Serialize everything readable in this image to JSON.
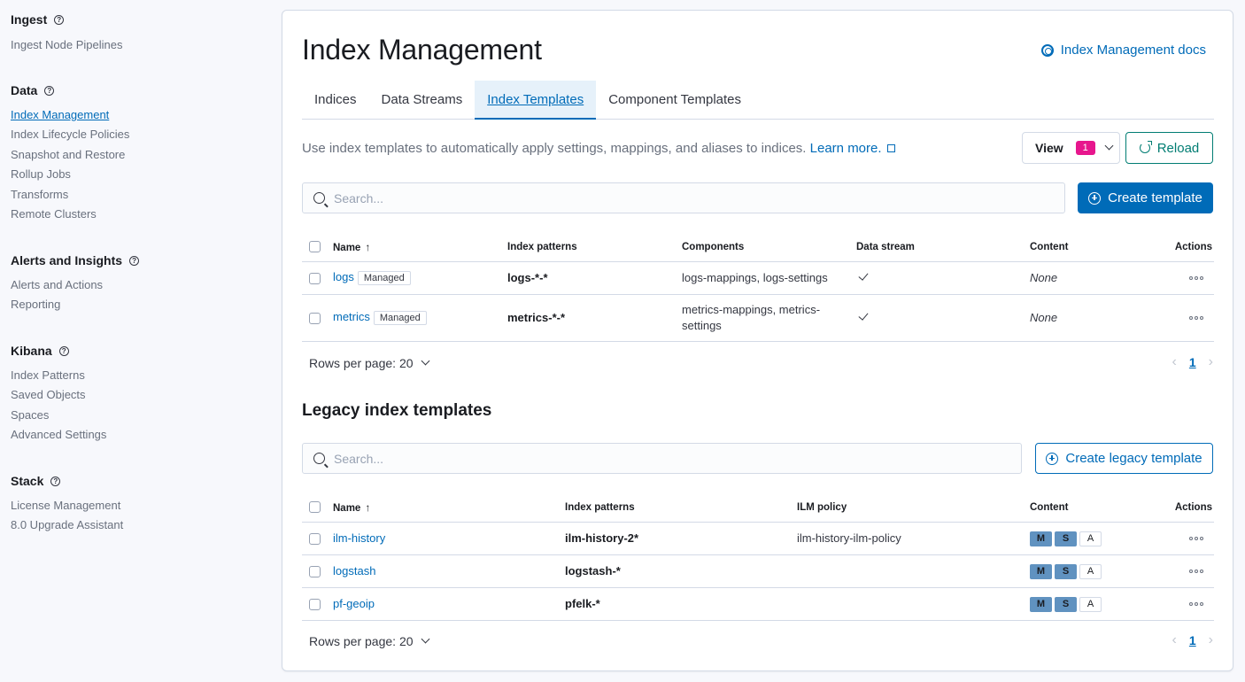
{
  "sidebar": {
    "groups": [
      {
        "title": "Ingest",
        "items": [
          "Ingest Node Pipelines"
        ]
      },
      {
        "title": "Data",
        "items": [
          "Index Management",
          "Index Lifecycle Policies",
          "Snapshot and Restore",
          "Rollup Jobs",
          "Transforms",
          "Remote Clusters"
        ]
      },
      {
        "title": "Alerts and Insights",
        "items": [
          "Alerts and Actions",
          "Reporting"
        ]
      },
      {
        "title": "Kibana",
        "items": [
          "Index Patterns",
          "Saved Objects",
          "Spaces",
          "Advanced Settings"
        ]
      },
      {
        "title": "Stack",
        "items": [
          "License Management",
          "8.0 Upgrade Assistant"
        ]
      }
    ],
    "active_item": "Index Management"
  },
  "page": {
    "title": "Index Management",
    "docs_link": "Index Management docs",
    "tabs": [
      "Indices",
      "Data Streams",
      "Index Templates",
      "Component Templates"
    ],
    "active_tab": "Index Templates",
    "description": "Use index templates to automatically apply settings, mappings, and aliases to indices.",
    "learn_more": "Learn more.",
    "view_label": "View",
    "view_count": "1",
    "reload_label": "Reload"
  },
  "templates": {
    "search_placeholder": "Search...",
    "create_label": "Create template",
    "columns": [
      "Name",
      "Index patterns",
      "Components",
      "Data stream",
      "Content",
      "Actions"
    ],
    "rows": [
      {
        "name": "logs",
        "badge": "Managed",
        "pattern": "logs-*-*",
        "components": "logs-mappings, logs-settings",
        "data_stream": true,
        "content": "None"
      },
      {
        "name": "metrics",
        "badge": "Managed",
        "pattern": "metrics-*-*",
        "components": "metrics-mappings, metrics-settings",
        "data_stream": true,
        "content": "None"
      }
    ],
    "rows_per_page": "Rows per page: 20",
    "current_page": "1"
  },
  "legacy": {
    "title": "Legacy index templates",
    "search_placeholder": "Search...",
    "create_label": "Create legacy template",
    "columns": [
      "Name",
      "Index patterns",
      "ILM policy",
      "Content",
      "Actions"
    ],
    "content_labels": [
      "M",
      "S",
      "A"
    ],
    "rows": [
      {
        "name": "ilm-history",
        "pattern": "ilm-history-2*",
        "ilm_policy": "ilm-history-ilm-policy"
      },
      {
        "name": "logstash",
        "pattern": "logstash-*",
        "ilm_policy": ""
      },
      {
        "name": "pf-geoip",
        "pattern": "pfelk-*",
        "ilm_policy": ""
      }
    ],
    "rows_per_page": "Rows per page: 20",
    "current_page": "1"
  },
  "colors": {
    "accent": "#006bb8",
    "reload": "#017d73",
    "badge": "#e7168d",
    "content_badge": "#6092c0"
  }
}
